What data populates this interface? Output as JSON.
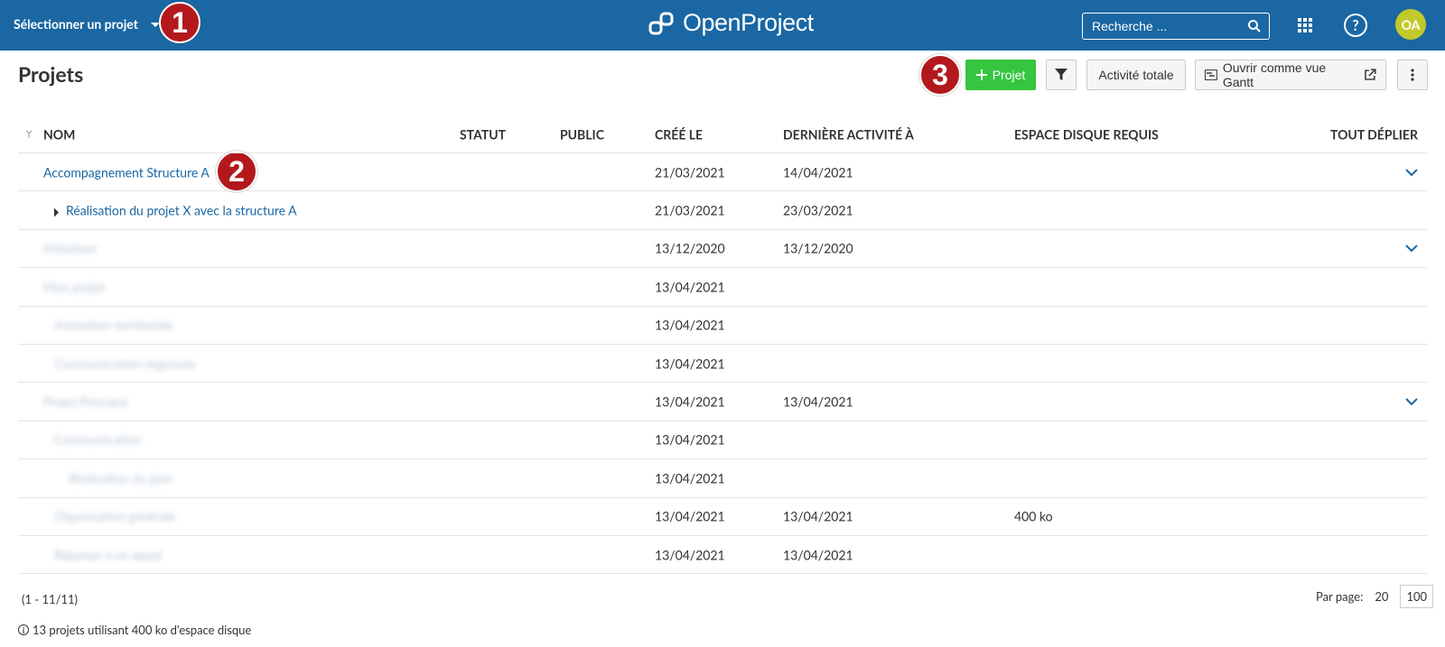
{
  "header": {
    "project_selector": "Sélectionner un projet",
    "logo_text": "OpenProject",
    "search_placeholder": "Recherche ...",
    "avatar_initials": "OA",
    "help": "?"
  },
  "annotations": [
    "1",
    "2",
    "3"
  ],
  "toolbar": {
    "title": "Projets",
    "new_project": "Projet",
    "total_activity": "Activité totale",
    "gantt": "Ouvrir comme vue Gantt"
  },
  "table": {
    "columns": {
      "name": "NOM",
      "statut": "STATUT",
      "public": "PUBLIC",
      "created": "CRÉÉ LE",
      "last_activity": "DERNIÈRE ACTIVITÉ À",
      "disk": "ESPACE DISQUE REQUIS",
      "expand_all": "TOUT DÉPLIER"
    },
    "rows": [
      {
        "name": "Accompagnement Structure A",
        "created": "21/03/2021",
        "last": "14/04/2021",
        "disk": ""
      },
      {
        "name": "Réalisation du projet X avec la structure A",
        "created": "21/03/2021",
        "last": "23/03/2021",
        "disk": ""
      },
      {
        "name": "Initiatives",
        "created": "13/12/2020",
        "last": "13/12/2020",
        "disk": ""
      },
      {
        "name": "Mon projet",
        "created": "13/04/2021",
        "last": "",
        "disk": ""
      },
      {
        "name": "Animation territoriale",
        "created": "13/04/2021",
        "last": "",
        "disk": ""
      },
      {
        "name": "Communication régionale",
        "created": "13/04/2021",
        "last": "",
        "disk": ""
      },
      {
        "name": "Projet Principal",
        "created": "13/04/2021",
        "last": "13/04/2021",
        "disk": ""
      },
      {
        "name": "Communication",
        "created": "13/04/2021",
        "last": "",
        "disk": ""
      },
      {
        "name": "Réalisation du plan",
        "created": "13/04/2021",
        "last": "",
        "disk": ""
      },
      {
        "name": "Organisation générale",
        "created": "13/04/2021",
        "last": "13/04/2021",
        "disk": "400 ko"
      },
      {
        "name": "Réponse à un appel",
        "created": "13/04/2021",
        "last": "13/04/2021",
        "disk": ""
      }
    ]
  },
  "footer": {
    "range": "(1 - 11/11)",
    "per_page_label": "Par page:",
    "per_page_options": [
      "20",
      "100"
    ],
    "disk_note": "13 projets utilisant 400 ko d'espace disque"
  },
  "colors": {
    "header_bg": "#1a67a3",
    "primary_button": "#35c53f",
    "annotation": "#b3191c",
    "avatar": "#c3c92b",
    "link": "#1a67a3"
  }
}
